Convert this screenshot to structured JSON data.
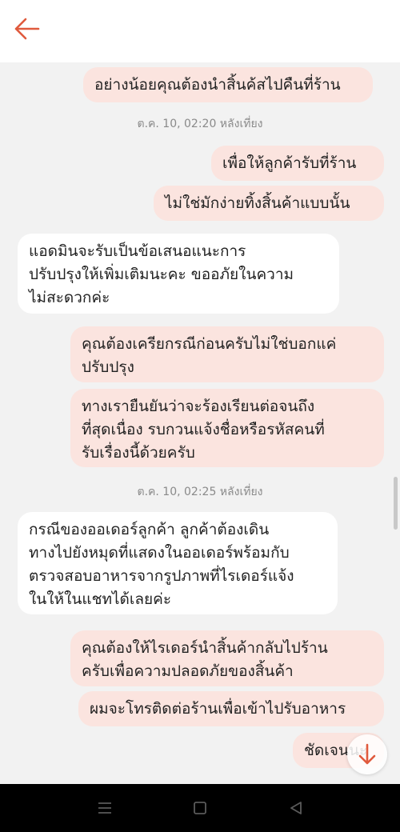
{
  "header": {
    "back_icon": "arrow-left-icon",
    "accent": "#e05a3d"
  },
  "messages": [
    {
      "side": "out",
      "text": "อย่างน้อยคุณต้องนำสิ้นค้สไปคืนที่ร้าน"
    },
    {
      "type": "timestamp",
      "text": "ต.ค. 10, 02:20 หลังเที่ยง"
    },
    {
      "side": "out",
      "text": "เพื่อให้ลูกค้ารับที่ร้าน"
    },
    {
      "side": "out",
      "text": "ไม่ใช่มักง่ายทิ้งสิ้นค้าแบบนั้น"
    },
    {
      "side": "in",
      "lines": [
        "แอดมินจะรับเป็นข้อเสนอแนะการ",
        "ปรับปรุงให้เพิ่มเติมนะคะ ขออภัยในความ",
        "ไม่สะดวกค่ะ"
      ]
    },
    {
      "side": "out",
      "lines": [
        "คุณต้องเครียกรณีก่อนครับไม่ใช่บอกแค่",
        "ปรับปรุง"
      ]
    },
    {
      "side": "out",
      "lines": [
        "ทางเรายืนยันว่าจะร้องเรียนต่อจนถึง",
        "ที่สุดเนื่อง รบกวนแจ้งชื่อหรือรหัสคนที่",
        "รับเรื่องนี้ด้วยครับ"
      ]
    },
    {
      "type": "timestamp",
      "text": "ต.ค. 10, 02:25 หลังเที่ยง"
    },
    {
      "side": "in",
      "lines": [
        "กรณีของออเดอร์ลูกค้า ลูกค้าต้องเดิน",
        "ทางไปยังหมุดที่แสดงในออเดอร์พร้อมกับ",
        "ตรวจสอบอาหารจากรูปภาพที่ไรเดอร์แจ้ง",
        "ในให้ในแชทได้เลยค่ะ"
      ]
    },
    {
      "side": "out",
      "lines": [
        "คุณต้องให้ไรเดอร์นำสิ้นค้ากลับไปร้าน",
        "ครับเพื่อความปลอดภัยของสิ้นค้า"
      ]
    },
    {
      "side": "out",
      "text": "ผมจะโทรติดต่อร้านเพื่อเข้าไปรับอาหาร"
    },
    {
      "side": "out",
      "text": "ชัดเจนนะ"
    }
  ],
  "scroll_down_icon": "arrow-down-icon",
  "navbar": {
    "icons": [
      "menu-icon",
      "home-square-icon",
      "back-triangle-icon"
    ]
  }
}
